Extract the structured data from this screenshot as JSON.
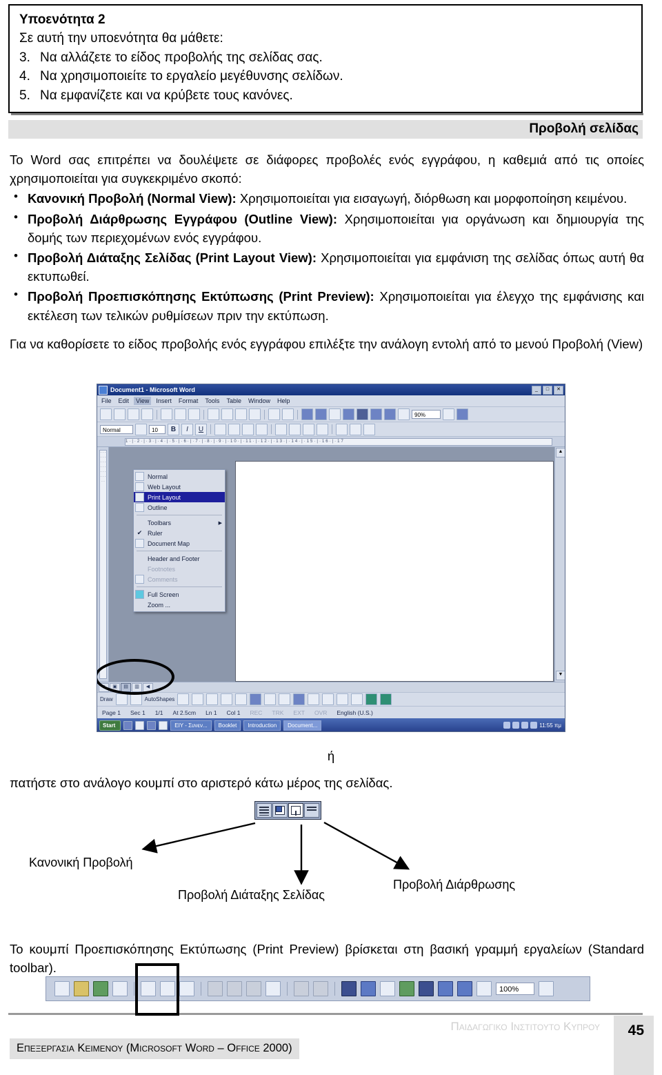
{
  "objectives": {
    "title": "Υποενότητα 2",
    "lead": "Σε αυτή την υποενότητα θα μάθετε:",
    "items": [
      {
        "num": "3.",
        "text": "Να αλλάζετε το είδος προβολής της σελίδας σας."
      },
      {
        "num": "4.",
        "text": "Να χρησιμοποιείτε το εργαλείο μεγέθυνσης σελίδων."
      },
      {
        "num": "5.",
        "text": "Να εμφανίζετε και να κρύβετε τους κανόνες."
      }
    ]
  },
  "section": {
    "heading": "Προβολή σελίδας",
    "band_color": "#e0e0e0"
  },
  "body": {
    "intro": "Το Word σας επιτρέπει να δουλέψετε σε διάφορες προβολές ενός εγγράφου, η καθεμιά από τις οποίες χρησιμοποιείται για συγκεκριμένο σκοπό:",
    "bullets": [
      {
        "term": "Κανονική Προβολή (Normal View):",
        "desc": " Χρησιμοποιείται για εισαγωγή, διόρθωση και μορφοποίηση κειμένου."
      },
      {
        "term": "Προβολή Διάρθρωσης Εγγράφου (Outline View):",
        "desc": " Χρησιμοποιείται για οργάνωση και δημιουργία της δομής των περιεχομένων ενός εγγράφου."
      },
      {
        "term": "Προβολή Διάταξης Σελίδας (Print Layout View):",
        "desc": " Χρησιμοποιείται για εμφάνιση της σελίδας όπως αυτή θα εκτυπωθεί."
      },
      {
        "term": "Προβολή Προεπισκόπησης Εκτύπωσης (Print Preview):",
        "desc": " Χρησιμοποιείται για έλεγχο της εμφάνισης και εκτέλεση των τελικών ρυθμίσεων πριν την εκτύπωση."
      }
    ],
    "after": "Για να καθορίσετε το είδος προβολής ενός εγγράφου επιλέξτε την ανάλογη εντολή από το μενού Προβολή (View)"
  },
  "word_screenshot": {
    "title": "Document1 - Microsoft Word",
    "window_buttons": [
      "_",
      "□",
      "✕"
    ],
    "menubar": [
      "File",
      "Edit",
      "View",
      "Insert",
      "Format",
      "Tools",
      "Table",
      "Window",
      "Help"
    ],
    "active_menu": "View",
    "view_menu": [
      {
        "label": "Normal",
        "icon": "normal-view-icon",
        "state": "normal"
      },
      {
        "label": "Web Layout",
        "icon": "web-layout-icon",
        "state": "normal"
      },
      {
        "label": "Print Layout",
        "icon": "print-layout-icon",
        "state": "selected"
      },
      {
        "label": "Outline",
        "icon": "outline-view-icon",
        "state": "normal"
      },
      {
        "label": "separator",
        "icon": "",
        "state": "separator"
      },
      {
        "label": "Toolbars",
        "icon": "none",
        "state": "submenu"
      },
      {
        "label": "Ruler",
        "icon": "checkmark-icon",
        "state": "checked"
      },
      {
        "label": "Document Map",
        "icon": "document-map-icon",
        "state": "normal"
      },
      {
        "label": "separator",
        "icon": "",
        "state": "separator"
      },
      {
        "label": "Header and Footer",
        "icon": "none",
        "state": "normal"
      },
      {
        "label": "Footnotes",
        "icon": "none",
        "state": "disabled"
      },
      {
        "label": "Comments",
        "icon": "comments-icon",
        "state": "disabled"
      },
      {
        "label": "separator",
        "icon": "",
        "state": "separator"
      },
      {
        "label": "Full Screen",
        "icon": "full-screen-icon",
        "state": "normal"
      },
      {
        "label": "Zoom ...",
        "icon": "none",
        "state": "normal"
      }
    ],
    "toolbar": {
      "zoom_value": "90%"
    },
    "format_bar": {
      "style": "Normal",
      "font_size": "10",
      "bold": "B",
      "italic": "I",
      "underline": "U"
    },
    "ruler_h_marks": "1·|·2·|·3·|·4·|·5·|·6·|·7·|·8·|·9·|·10·|·11·|·12·|·13·|·14·|·15·|·16·|·17",
    "ruler_v_marks": "· · · · · · · · · · · · · · · · · · · ·",
    "view_buttons": [
      {
        "name": "normal-view-button",
        "state": "normal"
      },
      {
        "name": "web-layout-view-button",
        "state": "normal"
      },
      {
        "name": "print-layout-view-button",
        "state": "pressed"
      },
      {
        "name": "outline-view-button",
        "state": "normal"
      }
    ],
    "drawing_bar": {
      "draw_label": "Draw",
      "autoshapes_label": "AutoShapes"
    },
    "statusbar": [
      {
        "text": "Page 1",
        "dim": false
      },
      {
        "text": "Sec 1",
        "dim": false
      },
      {
        "text": "1/1",
        "dim": false
      },
      {
        "text": "At 2.5cm",
        "dim": false
      },
      {
        "text": "Ln 1",
        "dim": false
      },
      {
        "text": "Col 1",
        "dim": false
      },
      {
        "text": "REC",
        "dim": true
      },
      {
        "text": "TRK",
        "dim": true
      },
      {
        "text": "EXT",
        "dim": true
      },
      {
        "text": "OVR",
        "dim": true
      },
      {
        "text": "English (U.S.)",
        "dim": false
      }
    ],
    "taskbar": {
      "start_label": "Start",
      "items": [
        "EIY - Συνεν...",
        "Booklet",
        "Introduction",
        "Document..."
      ],
      "clock": "11:55 πμ"
    }
  },
  "mid": {
    "or_word": "ή",
    "instruction": "πατήστε στο ανάλογο κουμπί στο αριστερό κάτω μέρος της σελίδας."
  },
  "callouts": {
    "normal": "Κανονική Προβολή",
    "print_layout": "Προβολή Διάταξης Σελίδας",
    "outline": "Προβολή Διάρθρωσης"
  },
  "closing": "Το κουμπί Προεπισκόπησης Εκτύπωσης (Print Preview) βρίσκεται στη βασική γραμμή εργαλείων (Standard toolbar).",
  "standard_toolbar": {
    "zoom_value": "100%"
  },
  "footer": {
    "organisation": "Παιδαγωγικο Ινστιτουτο Κυπρου",
    "page_number": "45",
    "course": "Επεξεργασια Κειμενου (Microsoft Word – Office 2000)"
  }
}
